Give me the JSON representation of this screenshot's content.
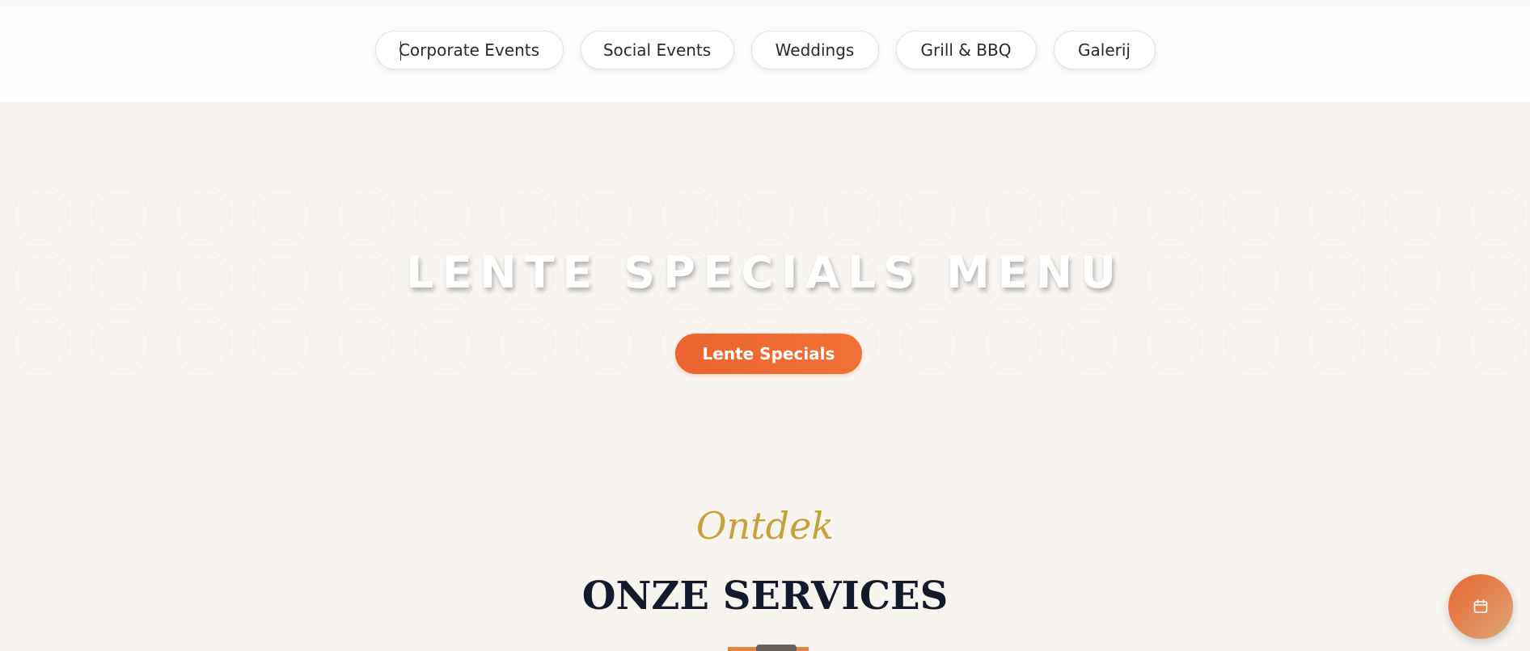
{
  "nav": {
    "pills": [
      {
        "label": "Corporate Events"
      },
      {
        "label": "Social Events"
      },
      {
        "label": "Weddings"
      },
      {
        "label": "Grill & BBQ"
      },
      {
        "label": "Galerij"
      }
    ]
  },
  "hero": {
    "title": "LENTE SPECIALS MENU",
    "button_label": "Lente Specials"
  },
  "services": {
    "script_label": "Ontdek",
    "title": "ONZE SERVICES"
  },
  "fab": {
    "icon": "calendar-icon"
  },
  "colors": {
    "accent": "#ea6430",
    "gold": "#c9a03a",
    "navy": "#141a2b",
    "background": "#f8f5f1"
  }
}
